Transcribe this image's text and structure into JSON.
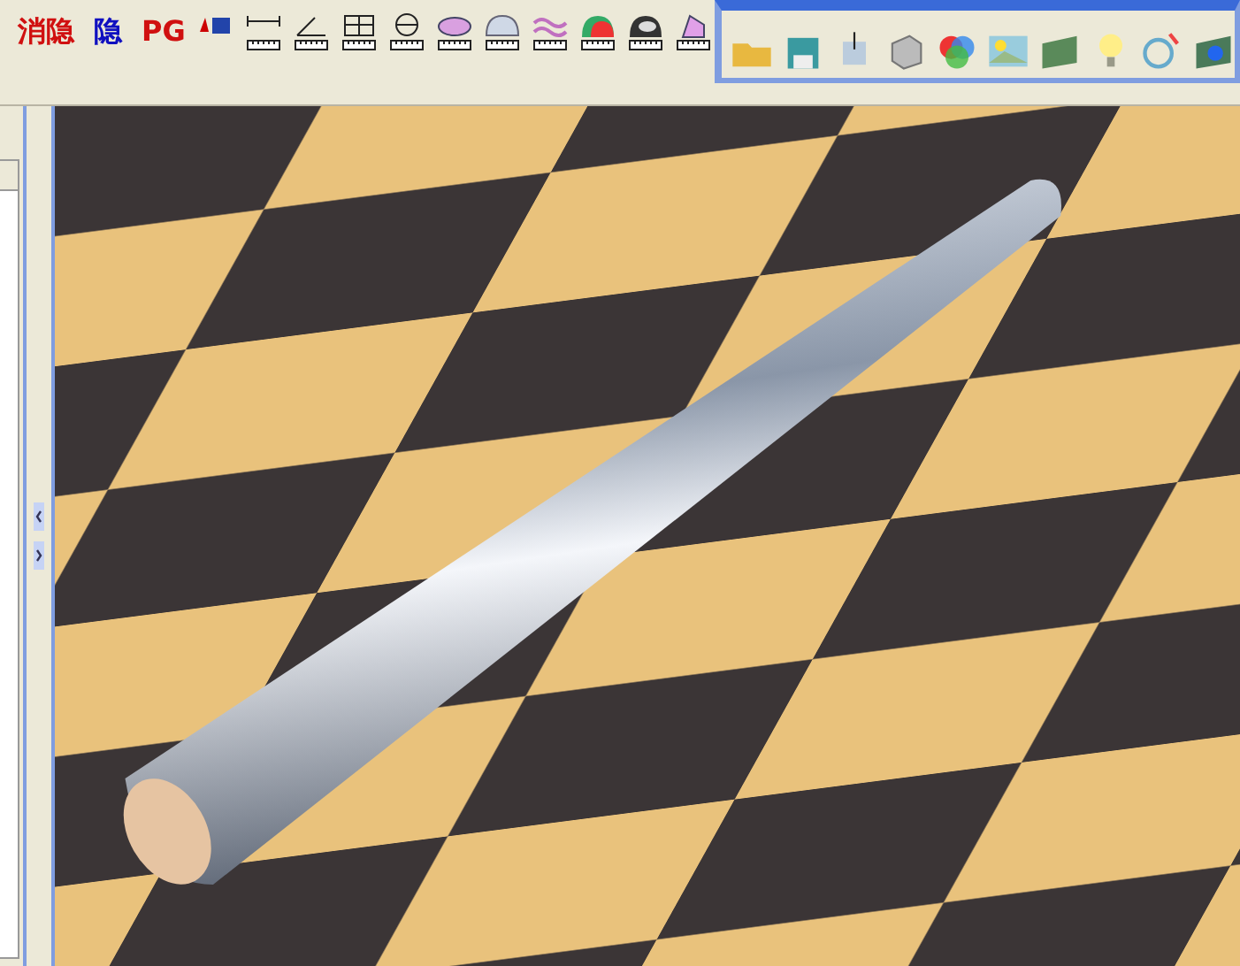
{
  "toolbar": {
    "text_buttons": [
      {
        "label": "消隐",
        "color": "#d01010"
      },
      {
        "label": "隐",
        "color": "#1010c0"
      },
      {
        "label": "PG",
        "color": "#d01010"
      }
    ]
  }
}
